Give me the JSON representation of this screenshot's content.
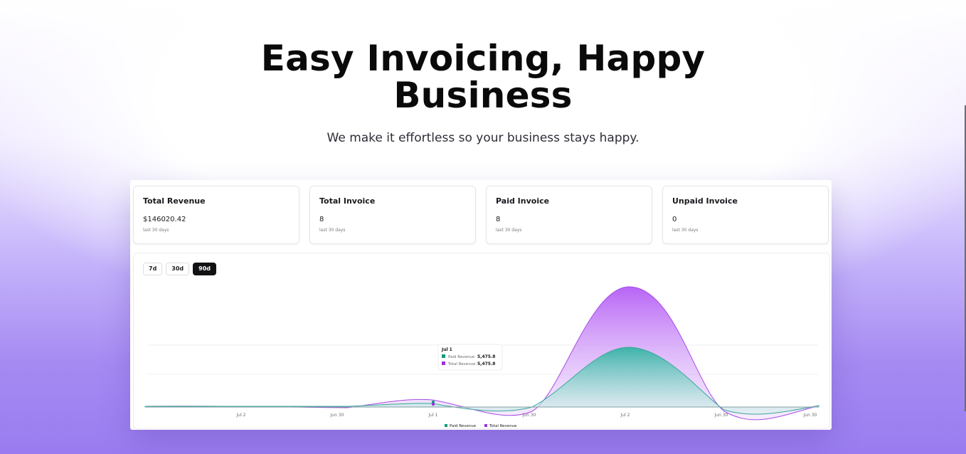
{
  "hero": {
    "title": "Easy Invoicing, Happy Business",
    "subtitle": "We make it effortless so your business stays happy."
  },
  "stats": [
    {
      "title": "Total Revenue",
      "value": "$146020.42",
      "sub": "last 30 days"
    },
    {
      "title": "Total Invoice",
      "value": "8",
      "sub": "last 30 days"
    },
    {
      "title": "Paid Invoice",
      "value": "8",
      "sub": "last 30 days"
    },
    {
      "title": "Unpaid Invoice",
      "value": "0",
      "sub": "last 30 days"
    }
  ],
  "ranges": [
    {
      "label": "7d",
      "active": false
    },
    {
      "label": "30d",
      "active": false
    },
    {
      "label": "90d",
      "active": true
    }
  ],
  "tooltip": {
    "date": "Jul 1",
    "rows": [
      {
        "label": "Paid Revenue",
        "value": "5,475.8",
        "color": "#0f9b7e"
      },
      {
        "label": "Total Revenue",
        "value": "5,475.8",
        "color": "#9b30e0"
      }
    ]
  },
  "chart_data": {
    "type": "area",
    "categories": [
      "Jul 2",
      "Jun 30",
      "Jul 1",
      "Jun 30",
      "Jul 2",
      "Jun 30",
      "Jun 30"
    ],
    "series": [
      {
        "name": "Paid Revenue",
        "color": "#2bb3a0"
      },
      {
        "name": "Total Revenue",
        "color": "#b45cf5"
      }
    ],
    "grid": true,
    "legend": "bottom"
  },
  "colors": {
    "accent": "#9b30e0",
    "paid": "#0f9b7e"
  }
}
